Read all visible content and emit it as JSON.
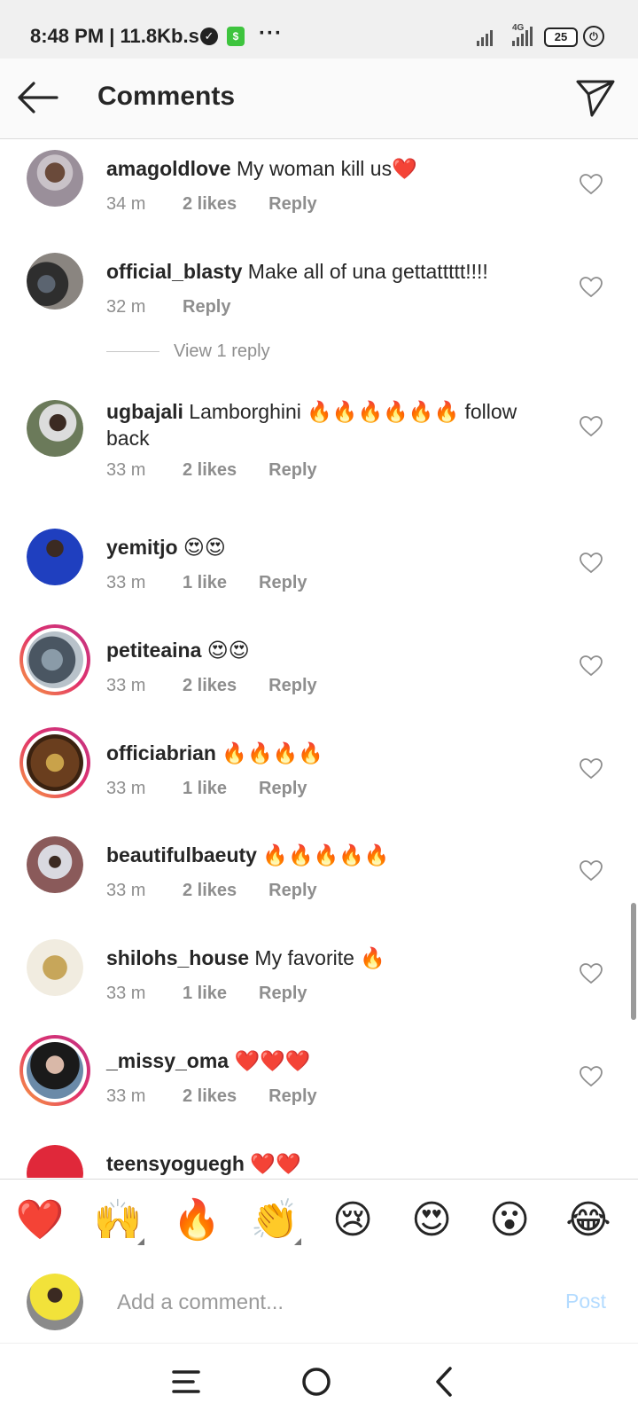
{
  "status_bar": {
    "time": "8:48 PM | 11.8Kb.s",
    "network": "4G",
    "battery": "25"
  },
  "header": {
    "title": "Comments"
  },
  "comments": [
    {
      "user": "amagoldlove",
      "text": " My woman kill us❤️",
      "time": "34 m",
      "likes": "2 likes",
      "reply": "Reply"
    },
    {
      "user": "official_blasty",
      "text": " Make all of una gettattttt!!!!",
      "time": "32 m",
      "likes": "",
      "reply": "Reply"
    },
    {
      "user": "ugbajali",
      "text": " Lamborghini 🔥🔥🔥🔥🔥🔥 follow back",
      "time": "33 m",
      "likes": "2 likes",
      "reply": "Reply"
    },
    {
      "user": "yemitjo",
      "text": " 😍😍",
      "time": "33 m",
      "likes": "1 like",
      "reply": "Reply"
    },
    {
      "user": "petiteaina",
      "text": " 😍😍",
      "time": "33 m",
      "likes": "2 likes",
      "reply": "Reply"
    },
    {
      "user": "officiabrian",
      "text": " 🔥🔥🔥🔥",
      "time": "33 m",
      "likes": "1 like",
      "reply": "Reply"
    },
    {
      "user": "beautifulbaeuty",
      "text": " 🔥🔥🔥🔥🔥",
      "time": "33 m",
      "likes": "2 likes",
      "reply": "Reply"
    },
    {
      "user": "shilohs_house",
      "text": " My favorite 🔥",
      "time": "33 m",
      "likes": "1 like",
      "reply": "Reply"
    },
    {
      "user": "_missy_oma",
      "text": " ❤️❤️❤️",
      "time": "33 m",
      "likes": "2 likes",
      "reply": "Reply"
    },
    {
      "user": "teensyoguegh",
      "text": " ❤️❤️",
      "time": "",
      "likes": "",
      "reply": ""
    }
  ],
  "view_replies": "View 1 reply",
  "emoji_bar": [
    "❤️",
    "🙌",
    "🔥",
    "👏",
    "😢",
    "😍",
    "😮",
    "😂"
  ],
  "comment_input": {
    "placeholder": "Add a comment...",
    "post_label": "Post"
  },
  "colors": {
    "accent_link": "#b3dbff",
    "muted_text": "#8e8e8e",
    "story_ring": "#e1306c"
  }
}
